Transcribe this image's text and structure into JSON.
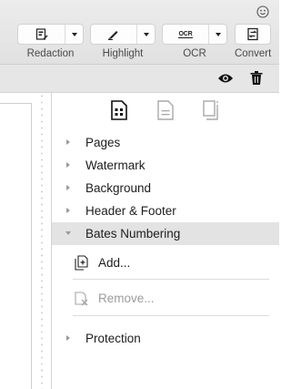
{
  "toolbar": {
    "tools": [
      {
        "label": "Redaction",
        "icon": "redaction-icon"
      },
      {
        "label": "Highlight",
        "icon": "highlight-pen-icon"
      },
      {
        "label": "OCR",
        "icon": "ocr-icon",
        "glyph": "OCR"
      },
      {
        "label": "Convert",
        "icon": "convert-icon"
      }
    ]
  },
  "subbar": {
    "icons": [
      "eye-icon",
      "trash-icon"
    ]
  },
  "panel": {
    "tabs": [
      "page-tools-tab-icon",
      "document-tab-icon",
      "crop-tab-icon"
    ],
    "sections": [
      {
        "label": "Pages",
        "expanded": false
      },
      {
        "label": "Watermark",
        "expanded": false
      },
      {
        "label": "Background",
        "expanded": false
      },
      {
        "label": "Header & Footer",
        "expanded": false
      },
      {
        "label": "Bates Numbering",
        "expanded": true
      },
      {
        "label": "Protection",
        "expanded": false
      }
    ],
    "bates_actions": [
      {
        "label": "Add...",
        "enabled": true
      },
      {
        "label": "Remove...",
        "enabled": false
      }
    ]
  },
  "colors": {
    "toolbar_bg": "#e5e5e5",
    "selected_row": "#e3e3e3",
    "disabled_text": "#9b9b9b"
  }
}
